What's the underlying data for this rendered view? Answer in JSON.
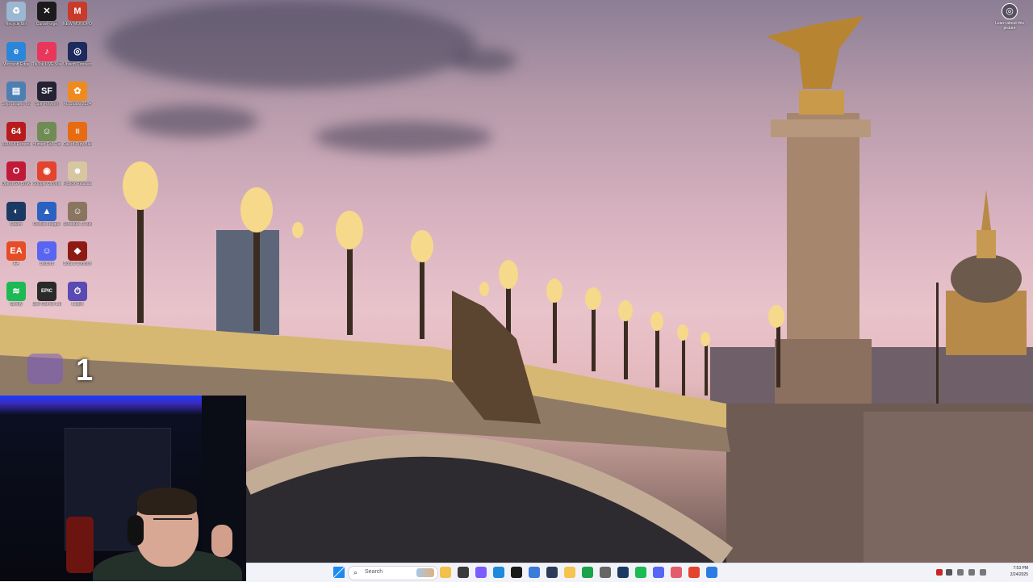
{
  "desktop_icons": [
    {
      "label": "Recycle Bin",
      "icon": "recycle-bin-icon",
      "color": "#9bb7d1",
      "glyph": "♻"
    },
    {
      "label": "CurseForge",
      "icon": "curseforge-icon",
      "color": "#1b1b1b",
      "glyph": "✕"
    },
    {
      "label": "NEW MONOPO...",
      "icon": "monopoly-icon",
      "color": "#c83a2a",
      "glyph": "M"
    },
    {
      "label": "Microsoft Edge",
      "icon": "edge-icon",
      "color": "#2a86d9",
      "glyph": "e"
    },
    {
      "label": "TikTok LIVE Studio",
      "icon": "tiktok-icon",
      "color": "#e8375a",
      "glyph": "♪"
    },
    {
      "label": "Ubisoft Connect",
      "icon": "ubisoft-icon",
      "color": "#1d2a5c",
      "glyph": "◎"
    },
    {
      "label": "Ship Graphs Tool",
      "icon": "app-icon",
      "color": "#4d7fb3",
      "glyph": "▤"
    },
    {
      "label": "Spin Rhythm",
      "icon": "spin-rhythm-icon",
      "color": "#232334",
      "glyph": "SF"
    },
    {
      "label": "FL Studio 2024",
      "icon": "fl-studio-icon",
      "color": "#ef8a1e",
      "glyph": "✿"
    },
    {
      "label": "AIDA64 Extreme",
      "icon": "aida64-icon",
      "color": "#b81b1b",
      "glyph": "64"
    },
    {
      "label": "Human Fall Flat",
      "icon": "human-fall-flat-icon",
      "color": "#6f8c55",
      "glyph": "☺"
    },
    {
      "label": "Call of Duty Black Ops III",
      "icon": "cod-icon",
      "color": "#e66b12",
      "glyph": "|||"
    },
    {
      "label": "Opera GX Browser",
      "icon": "opera-gx-icon",
      "color": "#c01a38",
      "glyph": "O"
    },
    {
      "label": "Google Chrome",
      "icon": "chrome-icon",
      "color": "#e4432d",
      "glyph": "◉"
    },
    {
      "label": "Roblox Retaliation",
      "icon": "roblox-icon",
      "color": "#d7c7a0",
      "glyph": "☻"
    },
    {
      "label": "Steam",
      "icon": "steam-icon",
      "color": "#1b3a63",
      "glyph": "◐"
    },
    {
      "label": "Rocket League",
      "icon": "rocket-league-icon",
      "color": "#2b62c2",
      "glyph": "▲"
    },
    {
      "label": "Schedule 1 Runaway",
      "icon": "schedule-icon",
      "color": "#8a7660",
      "glyph": "☺"
    },
    {
      "label": "EA",
      "icon": "ea-icon",
      "color": "#e44d25",
      "glyph": "EA"
    },
    {
      "label": "Discord",
      "icon": "discord-icon",
      "color": "#5865f2",
      "glyph": "☺"
    },
    {
      "label": "Dota 2 Crimson",
      "icon": "dota-icon",
      "color": "#8e1a14",
      "glyph": "◆"
    },
    {
      "label": "Spotify",
      "icon": "spotify-icon",
      "color": "#1db954",
      "glyph": "≋"
    },
    {
      "label": "Epic Games Launcher",
      "icon": "epic-games-icon",
      "color": "#2a2a2a",
      "glyph": "EPIC"
    },
    {
      "label": "Lasplit",
      "icon": "livesplit-icon",
      "color": "#5a4ab3",
      "glyph": "⏱"
    }
  ],
  "top_right": {
    "label": "Learn about this picture",
    "icon": "camera-icon"
  },
  "overlay_number": "1",
  "taskbar": {
    "search_placeholder": "Search",
    "apps": [
      {
        "icon": "file-explorer-icon",
        "color": "#f2c14b"
      },
      {
        "icon": "task-view-icon",
        "color": "#3b3b3b"
      },
      {
        "icon": "copilot-icon",
        "color": "#7a5cff"
      },
      {
        "icon": "edge-icon",
        "color": "#1f8ad9"
      },
      {
        "icon": "capcut-icon",
        "color": "#1a1a1a"
      },
      {
        "icon": "photos-icon",
        "color": "#3b7bd9"
      },
      {
        "icon": "terminal-icon",
        "color": "#2d3b5a"
      },
      {
        "icon": "folder-icon",
        "color": "#f4c44e"
      },
      {
        "icon": "xbox-icon",
        "color": "#1aa34a"
      },
      {
        "icon": "mic-icon",
        "color": "#666"
      },
      {
        "icon": "steam-icon",
        "color": "#1b3a63"
      },
      {
        "icon": "spotify-icon",
        "color": "#1db954"
      },
      {
        "icon": "discord-icon",
        "color": "#5865f2"
      },
      {
        "icon": "obs-icon",
        "color": "#e35d6a"
      },
      {
        "icon": "chrome-icon",
        "color": "#e4432d"
      },
      {
        "icon": "store-icon",
        "color": "#2c7be5"
      }
    ],
    "clock_time": "7:53 PM",
    "clock_date": "2/24/2025"
  }
}
